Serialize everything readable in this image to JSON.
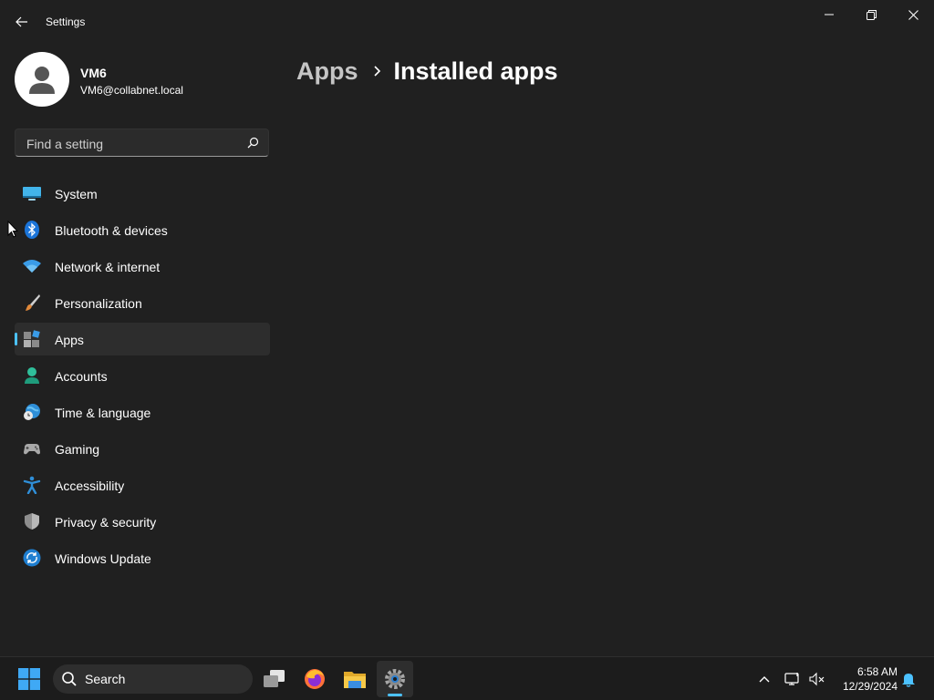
{
  "window": {
    "title": "Settings",
    "back_icon": "arrow-left-icon",
    "controls": [
      "minimize-icon",
      "restore-icon",
      "close-icon"
    ]
  },
  "profile": {
    "name": "VM6",
    "email": "VM6@collabnet.local"
  },
  "search": {
    "placeholder": "Find a setting",
    "value": ""
  },
  "nav": {
    "items": [
      {
        "label": "System",
        "icon": "system-icon",
        "selected": false
      },
      {
        "label": "Bluetooth & devices",
        "icon": "bluetooth-icon",
        "selected": false
      },
      {
        "label": "Network & internet",
        "icon": "wifi-icon",
        "selected": false
      },
      {
        "label": "Personalization",
        "icon": "brush-icon",
        "selected": false
      },
      {
        "label": "Apps",
        "icon": "apps-icon",
        "selected": true
      },
      {
        "label": "Accounts",
        "icon": "accounts-icon",
        "selected": false
      },
      {
        "label": "Time & language",
        "icon": "globe-clock-icon",
        "selected": false
      },
      {
        "label": "Gaming",
        "icon": "gamepad-icon",
        "selected": false
      },
      {
        "label": "Accessibility",
        "icon": "accessibility-icon",
        "selected": false
      },
      {
        "label": "Privacy & security",
        "icon": "shield-icon",
        "selected": false
      },
      {
        "label": "Windows Update",
        "icon": "update-icon",
        "selected": false
      }
    ]
  },
  "breadcrumb": {
    "parent": "Apps",
    "current": "Installed apps"
  },
  "taskbar": {
    "search_label": "Search",
    "apps": [
      "windows-start-icon",
      "task-view-icon",
      "firefox-icon",
      "file-explorer-icon",
      "settings-gear-icon"
    ],
    "active_app": "settings-gear-icon",
    "tray": [
      "chevron-up-icon",
      "network-icon",
      "volume-muted-icon",
      "notification-bell-icon"
    ],
    "time": "6:58 AM",
    "date": "12/29/2024"
  },
  "colors": {
    "background": "#202020",
    "accent": "#4cc2ff",
    "selected_item": "#2d2d2d",
    "taskbar": "#1c1c1c"
  }
}
